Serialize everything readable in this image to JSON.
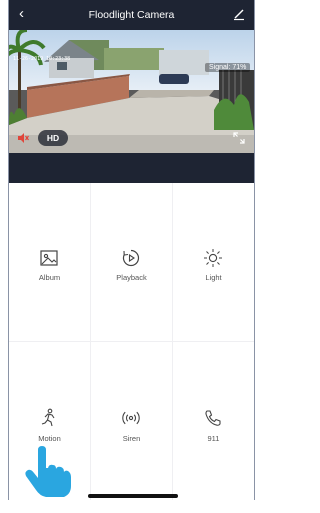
{
  "header": {
    "back_icon": "chevron-left-icon",
    "title": "Floodlight Camera",
    "edit_icon": "pencil-icon"
  },
  "video": {
    "timestamp": "11-26-2019 10:23:38",
    "signal": "Signal: 71%",
    "mute_icon": "speaker-muted-icon",
    "quality": "HD",
    "fullscreen_icon": "fullscreen-icon",
    "mute_color": "#e0453a"
  },
  "controls": [
    {
      "label": "Album",
      "icon": "album-icon"
    },
    {
      "label": "Playback",
      "icon": "playback-icon"
    },
    {
      "label": "Light",
      "icon": "light-icon"
    },
    {
      "label": "Motion",
      "icon": "motion-icon"
    },
    {
      "label": "Siren",
      "icon": "siren-icon"
    },
    {
      "label": "911",
      "icon": "phone-icon"
    }
  ],
  "colors": {
    "header_bg": "#1e2433",
    "accent": "#2aa6e0"
  },
  "overlay": {
    "hand_icon": "tap-hand-icon"
  }
}
